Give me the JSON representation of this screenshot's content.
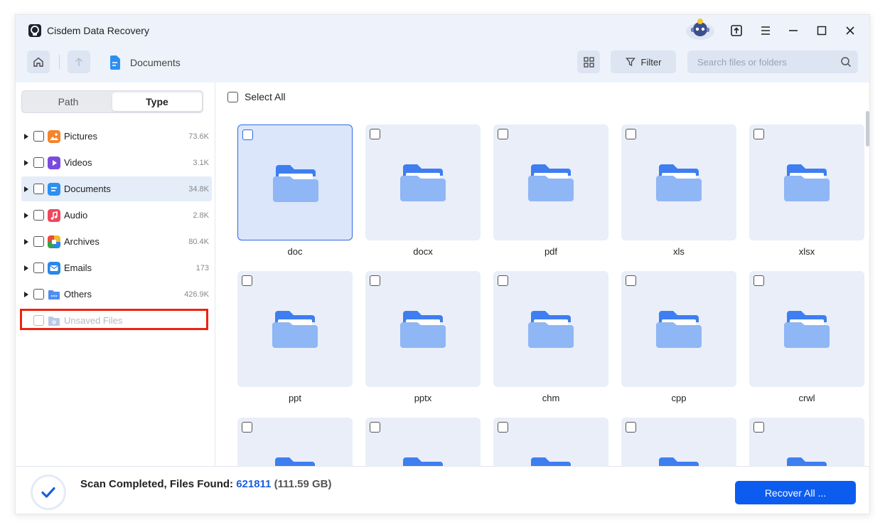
{
  "app": {
    "title": "Cisdem Data Recovery"
  },
  "header": {
    "breadcrumb": "Documents",
    "filter_label": "Filter",
    "search_placeholder": "Search files or folders"
  },
  "sidebar": {
    "tabs": [
      "Path",
      "Type"
    ],
    "active_tab": "Type",
    "categories": [
      {
        "label": "Pictures",
        "count": "73.6K",
        "icon": "pictures-icon",
        "color": "#f5842a"
      },
      {
        "label": "Videos",
        "count": "3.1K",
        "icon": "videos-icon",
        "color": "#7b4be0"
      },
      {
        "label": "Documents",
        "count": "34.8K",
        "icon": "documents-icon",
        "color": "#2d8ff0"
      },
      {
        "label": "Audio",
        "count": "2.8K",
        "icon": "audio-icon",
        "color": "#f0475c"
      },
      {
        "label": "Archives",
        "count": "80.4K",
        "icon": "archives-icon",
        "color": "#3a9e4f"
      },
      {
        "label": "Emails",
        "count": "173",
        "icon": "emails-icon",
        "color": "#2b86e8"
      },
      {
        "label": "Others",
        "count": "426.9K",
        "icon": "others-icon",
        "color": "#4d8ef0"
      },
      {
        "label": "Unsaved Files",
        "count": "",
        "icon": "unsaved-files-icon",
        "color": "#b9c9e6"
      }
    ]
  },
  "main": {
    "select_all_label": "Select All",
    "items": [
      "doc",
      "docx",
      "pdf",
      "xls",
      "xlsx",
      "ppt",
      "pptx",
      "chm",
      "cpp",
      "crwl",
      "",
      "",
      "",
      "",
      ""
    ]
  },
  "footer": {
    "status_prefix": "Scan Completed, Files Found: ",
    "files_found": "621811",
    "size": "(111.59 GB)",
    "recover_label": "Recover All ..."
  },
  "colors": {
    "accent": "#0d5cf0",
    "highlight": "#ee2211",
    "folder": "#8fb6f5"
  }
}
